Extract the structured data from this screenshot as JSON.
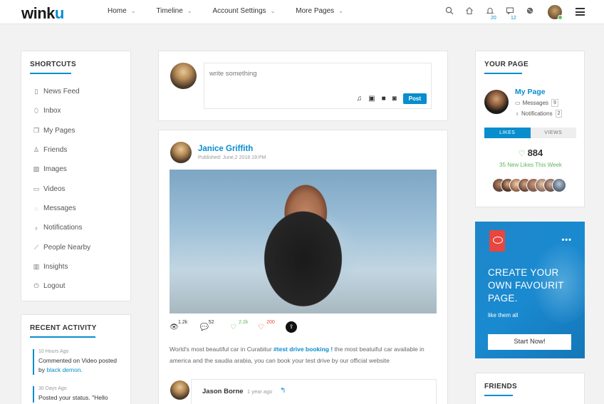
{
  "brand": {
    "logo_main": "wink",
    "logo_accent": "u"
  },
  "nav": [
    {
      "label": "Home"
    },
    {
      "label": "Timeline"
    },
    {
      "label": "Account Settings"
    },
    {
      "label": "More Pages"
    }
  ],
  "topbar": {
    "notif_count": "20",
    "message_count": "12"
  },
  "shortcuts": {
    "title": "Shortcuts",
    "items": [
      {
        "label": "News Feed",
        "icon": "document-icon"
      },
      {
        "label": "Inbox",
        "icon": "mouse-icon"
      },
      {
        "label": "My Pages",
        "icon": "pages-icon"
      },
      {
        "label": "Friends",
        "icon": "user-icon"
      },
      {
        "label": "Images",
        "icon": "image-icon"
      },
      {
        "label": "Videos",
        "icon": "video-icon"
      },
      {
        "label": "Messages",
        "icon": "chat-icon"
      },
      {
        "label": "Notifications",
        "icon": "bell-icon"
      },
      {
        "label": "People Nearby",
        "icon": "chart-up-icon"
      },
      {
        "label": "Insights",
        "icon": "bar-chart-icon"
      },
      {
        "label": "Logout",
        "icon": "power-icon"
      }
    ]
  },
  "recent_activity": {
    "title": "Recent Activity",
    "items": [
      {
        "time": "10 Hours Ago",
        "text": "Commented on Video posted",
        "by": "by",
        "link": "black demon."
      },
      {
        "time": "30 Days Ago",
        "text": "Posted your status. \"Hello",
        "by": "",
        "link": ""
      }
    ]
  },
  "composer": {
    "placeholder": "write something",
    "post_label": "Post"
  },
  "post": {
    "author": "Janice Griffith",
    "published": "Published: June,2 2018 19:PM",
    "stats": {
      "views": "1.2k",
      "comments": "52",
      "likes": "2.2k",
      "dislikes": "200"
    },
    "text_before": "World's most beautiful car in Curabitur",
    "tag": "#test drive booking !",
    "text_after": "the most beatuiful car available in america and the saudia arabia, you can book your test drive by our official website"
  },
  "comment": {
    "name": "Jason Borne",
    "time": "1 year ago"
  },
  "your_page": {
    "title": "Your Page",
    "name": "My Page",
    "messages_label": "Messages",
    "messages_count": "9",
    "notifications_label": "Notifications",
    "notifications_count": "2",
    "tab_likes": "LIKES",
    "tab_views": "VIEWS",
    "likes_count": "884",
    "likes_week": "35 New Likes This Week"
  },
  "promo": {
    "title": "CREATE YOUR OWN FAVOURIT PAGE.",
    "subtitle": "like them all",
    "button": "Start Now!",
    "dots": "•••"
  },
  "friends": {
    "title": "Friends"
  },
  "colors": {
    "accent": "#088dcd",
    "like": "#5cb85c",
    "dislike": "#e44a3c"
  }
}
